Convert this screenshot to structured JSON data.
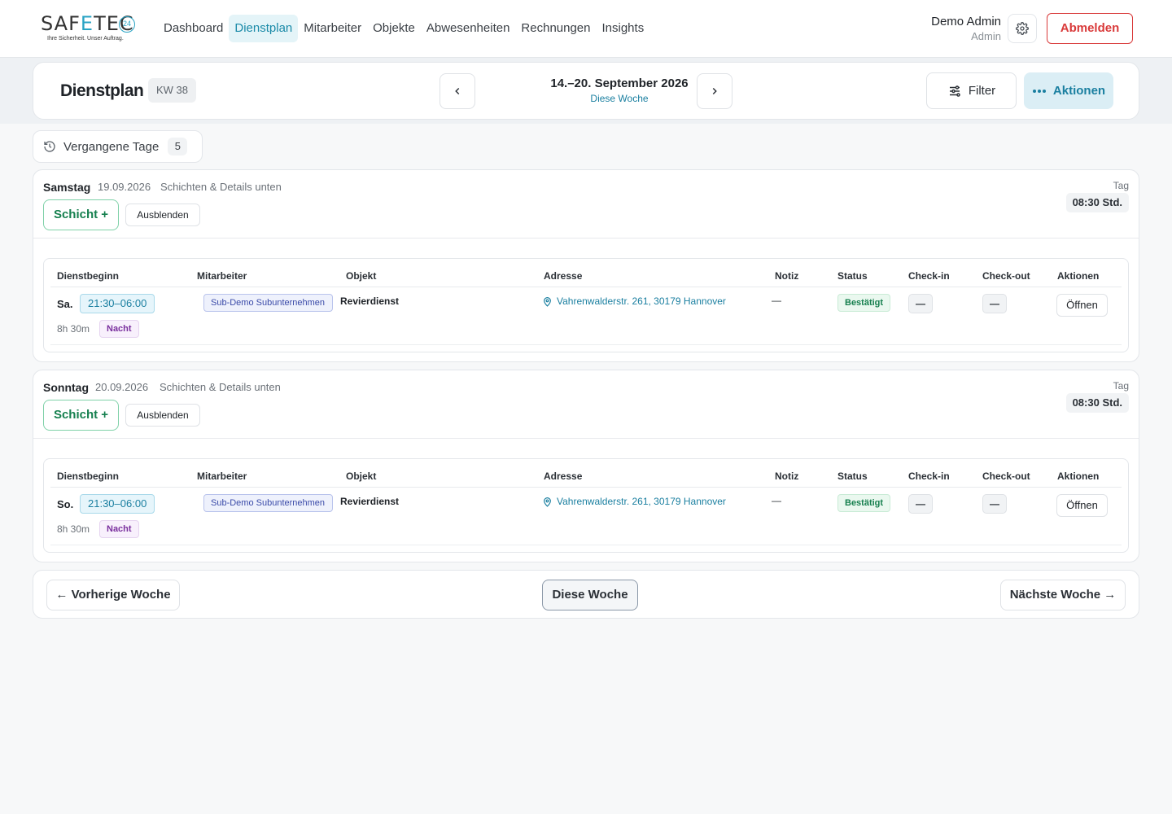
{
  "brand": {
    "name_a": "SAF",
    "name_b": "E",
    "name_c": "TE",
    "name_d": "C",
    "badge": "24",
    "tagline": "Ihre Sicherheit. Unser Auftrag."
  },
  "nav": {
    "items": [
      "Dashboard",
      "Dienstplan",
      "Mitarbeiter",
      "Objekte",
      "Abwesenheiten",
      "Rechnungen",
      "Insights"
    ],
    "active": "Dienstplan"
  },
  "user": {
    "name": "Demo Admin",
    "role": "Admin",
    "logout": "Abmelden"
  },
  "header": {
    "title": "Dienstplan",
    "week": "KW 38",
    "range": "14.–20. September 2026",
    "this_week": "Diese Woche",
    "filter": "Filter",
    "actions": "Aktionen"
  },
  "past": {
    "label": "Vergangene Tage",
    "count": "5"
  },
  "columns": [
    "Dienstbeginn",
    "Mitarbeiter",
    "Objekt",
    "Adresse",
    "Notiz",
    "Status",
    "Check-in",
    "Check-out",
    "Aktionen"
  ],
  "days": [
    {
      "name": "Samstag",
      "date": "19.09.2026",
      "sub": "Schichten & Details unten",
      "add": "Schicht +",
      "hide": "Ausblenden",
      "tag_label": "Tag",
      "tag_value": "08:30 Std.",
      "shift": {
        "day": "Sa.",
        "time": "21:30–06:00",
        "duration": "8h 30m",
        "type": "Nacht",
        "employee": "Sub-Demo Subunternehmen",
        "object": "Revierdienst",
        "address": "Vahrenwalderstr. 261, 30179 Hannover",
        "note": "—",
        "status": "Bestätigt",
        "checkin": "—",
        "checkout": "—",
        "action": "Öffnen"
      }
    },
    {
      "name": "Sonntag",
      "date": "20.09.2026",
      "sub": "Schichten & Details unten",
      "add": "Schicht +",
      "hide": "Ausblenden",
      "tag_label": "Tag",
      "tag_value": "08:30 Std.",
      "shift": {
        "day": "So.",
        "time": "21:30–06:00",
        "duration": "8h 30m",
        "type": "Nacht",
        "employee": "Sub-Demo Subunternehmen",
        "object": "Revierdienst",
        "address": "Vahrenwalderstr. 261, 30179 Hannover",
        "note": "—",
        "status": "Bestätigt",
        "checkin": "—",
        "checkout": "—",
        "action": "Öffnen"
      }
    }
  ],
  "footer": {
    "prev": "← Vorherige Woche",
    "current": "Diese Woche",
    "next": "Nächste Woche →"
  },
  "colors": {
    "accent": "#1a7fa0",
    "danger": "#d93a3a",
    "success": "#16804f"
  }
}
